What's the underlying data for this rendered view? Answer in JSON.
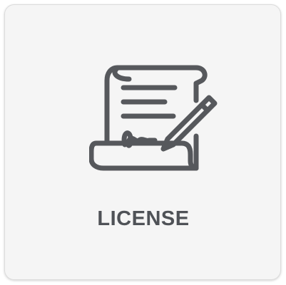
{
  "tile": {
    "label": "LICENSE",
    "icon": "license-document-signature-icon"
  },
  "colors": {
    "tile_background": "#f5f5f5",
    "tile_border": "#dcdcdc",
    "icon_stroke": "#56585c",
    "label_text": "#4f5257"
  }
}
